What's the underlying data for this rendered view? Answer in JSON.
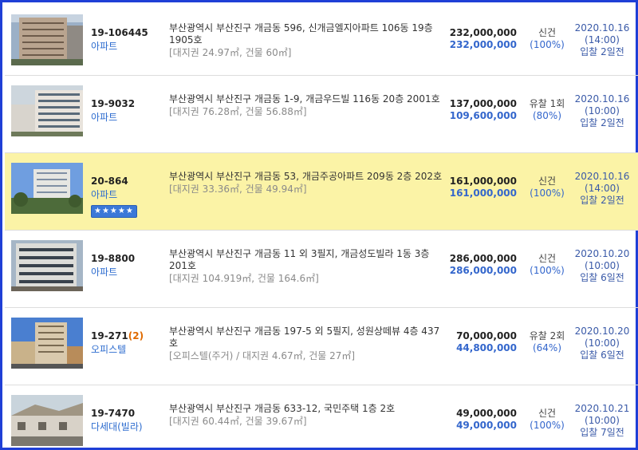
{
  "items": [
    {
      "case_no": "19-106445",
      "case_suffix": "",
      "type": "아파트",
      "address": "부산광역시 부산진구 개금동 596, 신개금엘지아파트 106동 19층 1905호",
      "area": "[대지권 24.97㎡, 건물 60㎡]",
      "appraised": "232,000,000",
      "min_price": "232,000,000",
      "status": "신건",
      "rate": "(100%)",
      "date": "2020.10.16",
      "time": "(14:00)",
      "dday": "입찰 2일전",
      "stars": "",
      "highlight": false
    },
    {
      "case_no": "19-9032",
      "case_suffix": "",
      "type": "아파트",
      "address": "부산광역시 부산진구 개금동 1-9, 개금우드빌 116동 20층 2001호",
      "area": "[대지권 76.28㎡, 건물 56.88㎡]",
      "appraised": "137,000,000",
      "min_price": "109,600,000",
      "status": "유찰 1회",
      "rate": "(80%)",
      "date": "2020.10.16",
      "time": "(10:00)",
      "dday": "입찰 2일전",
      "stars": "",
      "highlight": false
    },
    {
      "case_no": "20-864",
      "case_suffix": "",
      "type": "아파트",
      "address": "부산광역시 부산진구 개금동 53, 개금주공아파트 209동 2층 202호",
      "area": "[대지권 33.36㎡, 건물 49.94㎡]",
      "appraised": "161,000,000",
      "min_price": "161,000,000",
      "status": "신건",
      "rate": "(100%)",
      "date": "2020.10.16",
      "time": "(14:00)",
      "dday": "입찰 2일전",
      "stars": "★★★★★",
      "highlight": true
    },
    {
      "case_no": "19-8800",
      "case_suffix": "",
      "type": "아파트",
      "address": "부산광역시 부산진구 개금동 11 외 3필지, 개금성도빌라 1동 3층 201호",
      "area": "[대지권 104.919㎡, 건물 164.6㎡]",
      "appraised": "286,000,000",
      "min_price": "286,000,000",
      "status": "신건",
      "rate": "(100%)",
      "date": "2020.10.20",
      "time": "(10:00)",
      "dday": "입찰 6일전",
      "stars": "",
      "highlight": false
    },
    {
      "case_no": "19-271",
      "case_suffix": "(2)",
      "type": "오피스텔",
      "address": "부산광역시 부산진구 개금동 197-5 외 5필지, 성원상떼뷰 4층 437호",
      "area": "[오피스텔(주거) / 대지권 4.67㎡, 건물 27㎡]",
      "appraised": "70,000,000",
      "min_price": "44,800,000",
      "status": "유찰 2회",
      "rate": "(64%)",
      "date": "2020.10.20",
      "time": "(10:00)",
      "dday": "입찰 6일전",
      "stars": "",
      "highlight": false
    },
    {
      "case_no": "19-7470",
      "case_suffix": "",
      "type": "다세대(빌라)",
      "address": "부산광역시 부산진구 개금동 633-12, 국민주택 1층 2호",
      "area": "[대지권 60.44㎡, 건물 39.67㎡]",
      "appraised": "49,000,000",
      "min_price": "49,000,000",
      "status": "신건",
      "rate": "(100%)",
      "date": "2020.10.21",
      "time": "(10:00)",
      "dday": "입찰 7일전",
      "stars": "",
      "highlight": false
    }
  ],
  "colors": {
    "frame": "#1f3fd6",
    "highlight": "#fbf3a6",
    "link": "#2d6ccf",
    "min_price": "#3366cc",
    "suffix": "#e06a00"
  }
}
